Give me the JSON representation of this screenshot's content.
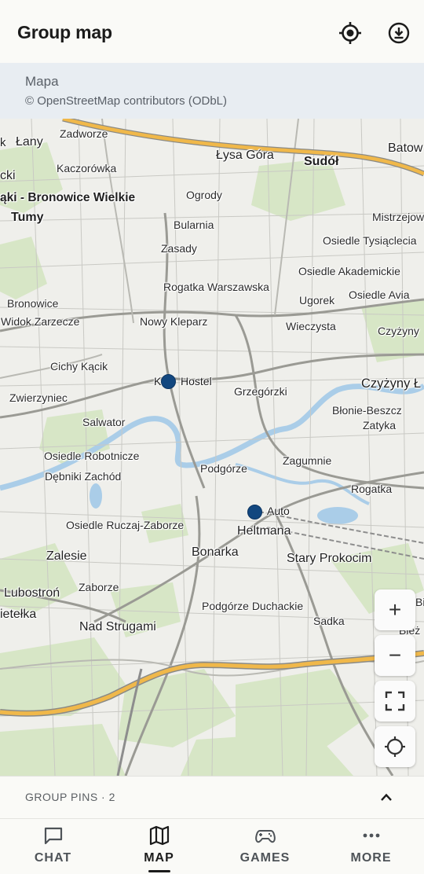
{
  "header": {
    "title": "Group map",
    "locate_icon": "crosshair-icon",
    "download_icon": "download-icon"
  },
  "attribution": {
    "title": "Mapa",
    "credit": "© OpenStreetMap contributors (ODbL)"
  },
  "map": {
    "places": [
      "Zadworze",
      "Łany",
      "Łysa Góra",
      "Sudół",
      "Batow",
      "Kaczorówka",
      "cki",
      "ąki - Bronowice Wielkie",
      "Ogrody",
      "Tumy",
      "Mistrzejow",
      "Bularnia",
      "Osiedle Tysiąclecia",
      "Zasady",
      "Osiedle Akademickie",
      "Rogatka Warszawska",
      "Osiedle Avia",
      "Bronowice",
      "Ugorek",
      "Widok Zarzecze",
      "Nowy Kleparz",
      "Wieczysta",
      "Czyżyny",
      "Cichy Kącik",
      "Grzegórzki",
      "Czyżyny Ł",
      "Zwierzyniec",
      "Błonie-Beszcz",
      "Salwator",
      "Zatyka",
      "Osiedle Robotnicze",
      "Zagumnie",
      "Podgórze",
      "Dębniki Zachód",
      "Rogatka",
      "Osiedle Ruczaj-Zaborze",
      "Heltmana",
      "Zalesie",
      "Bonarka",
      "Stary Prokocim",
      "Zaborze",
      "Lubostroń",
      "Podgórze Duchackie",
      "ietełka",
      "Sadka",
      "Nad Strugami",
      "Bie",
      "Bież"
    ],
    "pins": [
      {
        "label": "K",
        "trail": "Hostel"
      },
      {
        "label": "Auto",
        "trail": ""
      }
    ],
    "controls": {
      "zoom_in": "+",
      "zoom_out": "−",
      "fullscreen_icon": "fullscreen-icon",
      "recenter_icon": "recenter-icon"
    }
  },
  "group_pins": {
    "label": "GROUP PINS · 2",
    "chevron_icon": "chevron-up-icon"
  },
  "nav": [
    {
      "label": "CHAT",
      "icon": "chat-icon",
      "active": false
    },
    {
      "label": "MAP",
      "icon": "map-icon",
      "active": true
    },
    {
      "label": "GAMES",
      "icon": "gamepad-icon",
      "active": false
    },
    {
      "label": "MORE",
      "icon": "more-icon",
      "active": false
    }
  ],
  "colors": {
    "pin": "#12477f",
    "river": "#aacde8",
    "motorway": "#f0b84a",
    "park": "#d5e5c4"
  }
}
